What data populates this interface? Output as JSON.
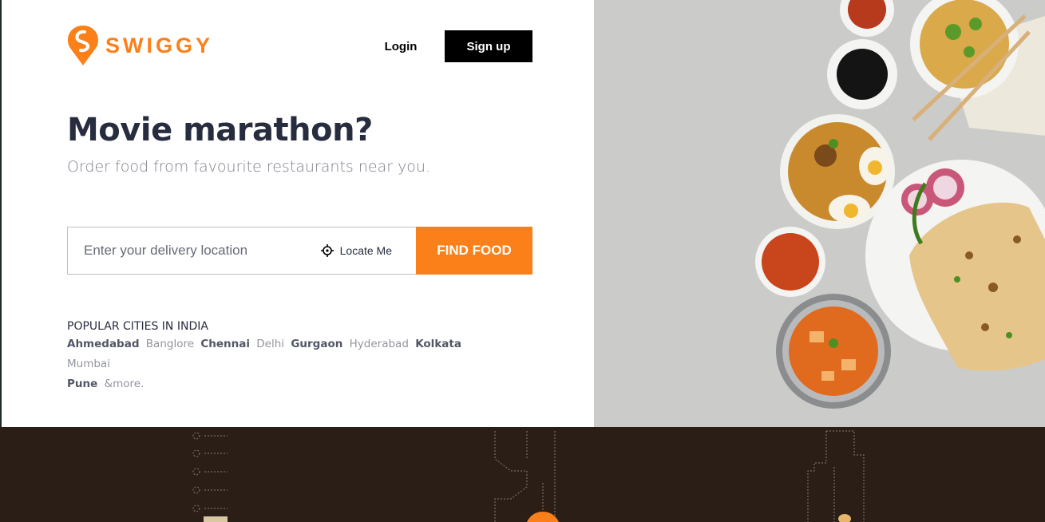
{
  "brand": {
    "name": "SWIGGY",
    "color": "#fc8019"
  },
  "header": {
    "login_label": "Login",
    "signup_label": "Sign up"
  },
  "hero": {
    "headline": "Movie marathon?",
    "subline": "Order food from favourite restaurants near you."
  },
  "search": {
    "placeholder": "Enter your delivery location",
    "locate_label": "Locate Me",
    "find_label": "FIND FOOD"
  },
  "cities": {
    "title": "POPULAR CITIES IN INDIA",
    "items": [
      "Ahmedabad",
      "Banglore",
      "Chennai",
      "Delhi",
      "Gurgaon",
      "Hyderabad",
      "Kolkata",
      "Mumbai",
      "Pune",
      "&more."
    ]
  },
  "icons": {
    "locate": "crosshair-icon",
    "logo": "swiggy-pin-icon"
  },
  "colors": {
    "accent": "#fc8019",
    "footer_bg": "#2b1e16",
    "text_dark": "#282c3f"
  }
}
